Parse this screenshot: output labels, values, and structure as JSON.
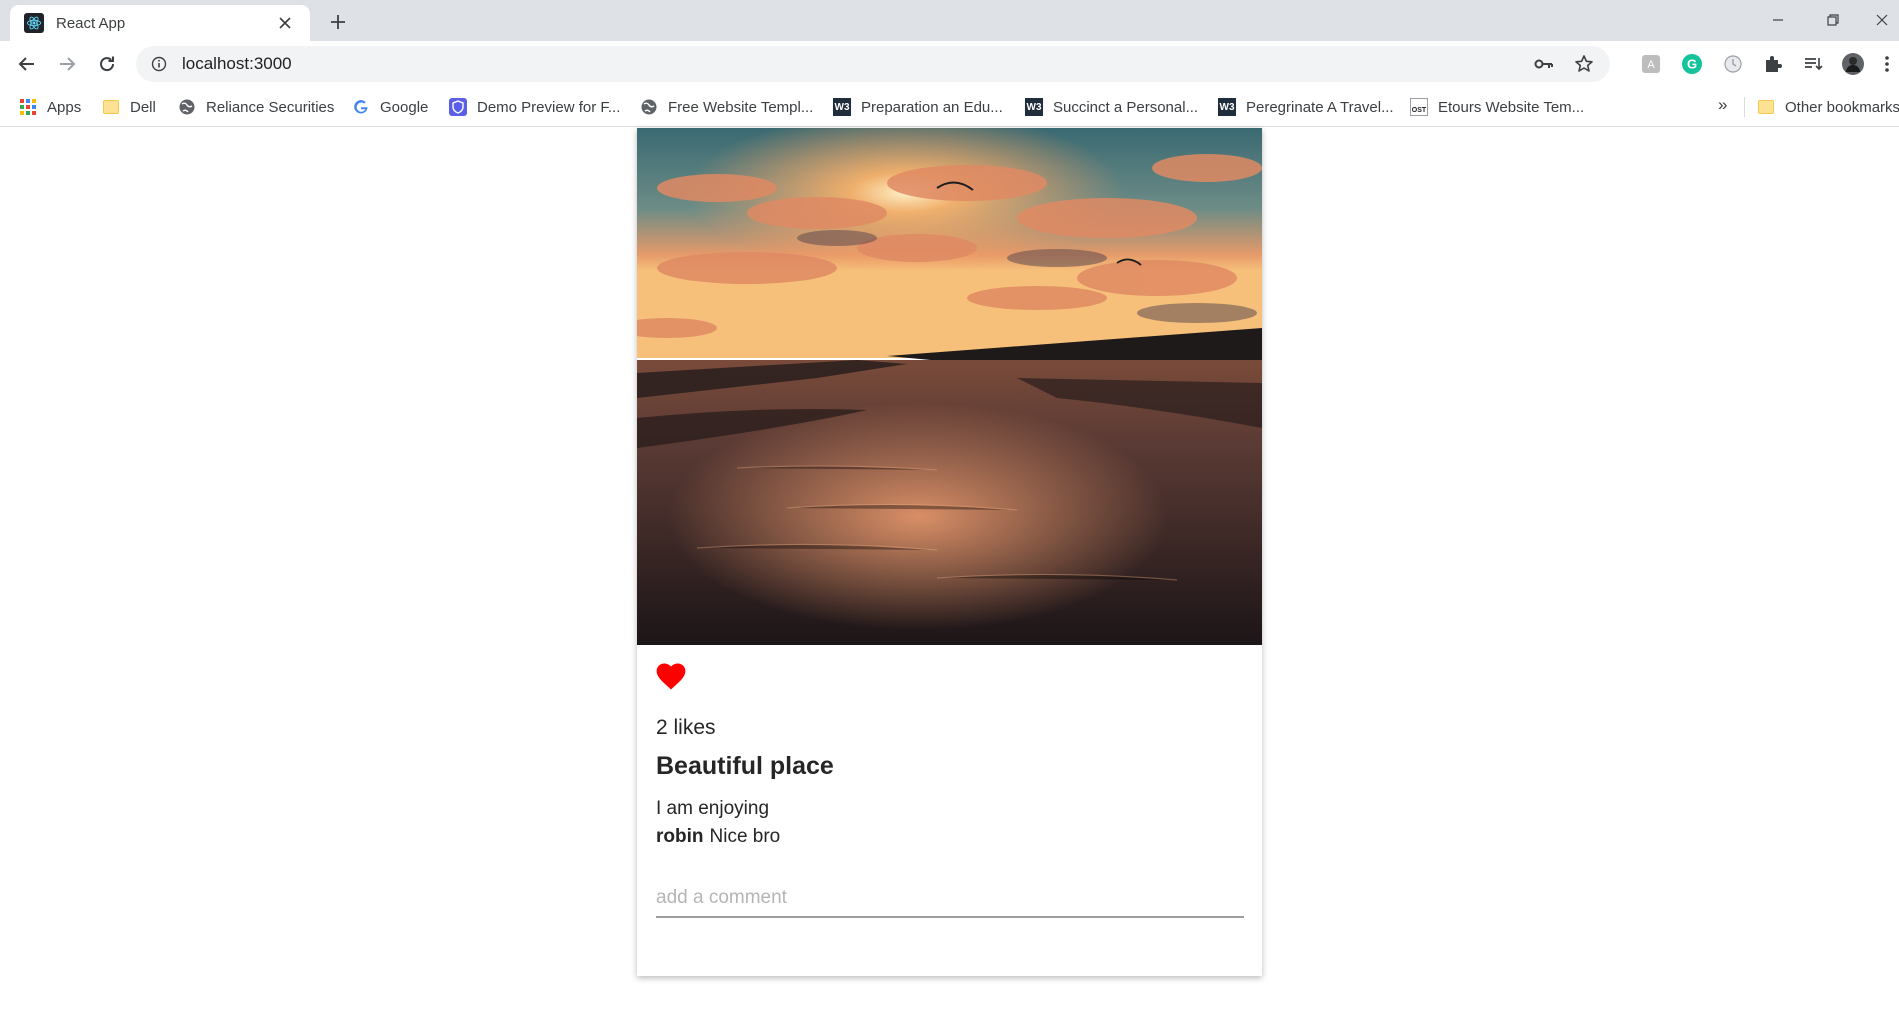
{
  "browser": {
    "tab": {
      "title": "React App",
      "favicon": "react-icon"
    },
    "address_bar": {
      "url": "localhost:3000"
    },
    "bookmarks": [
      {
        "label": "Apps",
        "icon": "apps-grid-icon"
      },
      {
        "label": "Dell",
        "icon": "folder-icon"
      },
      {
        "label": "Reliance Securities",
        "icon": "globe-icon"
      },
      {
        "label": "Google",
        "icon": "google-icon"
      },
      {
        "label": "Demo Preview for F...",
        "icon": "shield-icon"
      },
      {
        "label": "Free Website Templ...",
        "icon": "globe-icon"
      },
      {
        "label": "Preparation an Edu...",
        "icon": "w3-icon"
      },
      {
        "label": "Succinct a Personal...",
        "icon": "w3-icon"
      },
      {
        "label": "Peregrinate A Travel...",
        "icon": "w3-icon"
      },
      {
        "label": "Etours Website Tem...",
        "icon": "ost-icon"
      }
    ],
    "bookmarks_overflow": "»",
    "other_bookmarks": "Other bookmarks",
    "w3_badge": "W3",
    "ost_badge": "OST"
  },
  "post": {
    "likes": "2 likes",
    "liked": true,
    "title": "Beautiful place",
    "description": "I am enjoying",
    "comments": [
      {
        "user": "robin",
        "text": "Nice bro"
      }
    ],
    "comment_placeholder": "add a comment"
  },
  "colors": {
    "heart": "#ff0000",
    "tab_strip": "#dee1e6",
    "omnibox": "#f1f3f4"
  }
}
